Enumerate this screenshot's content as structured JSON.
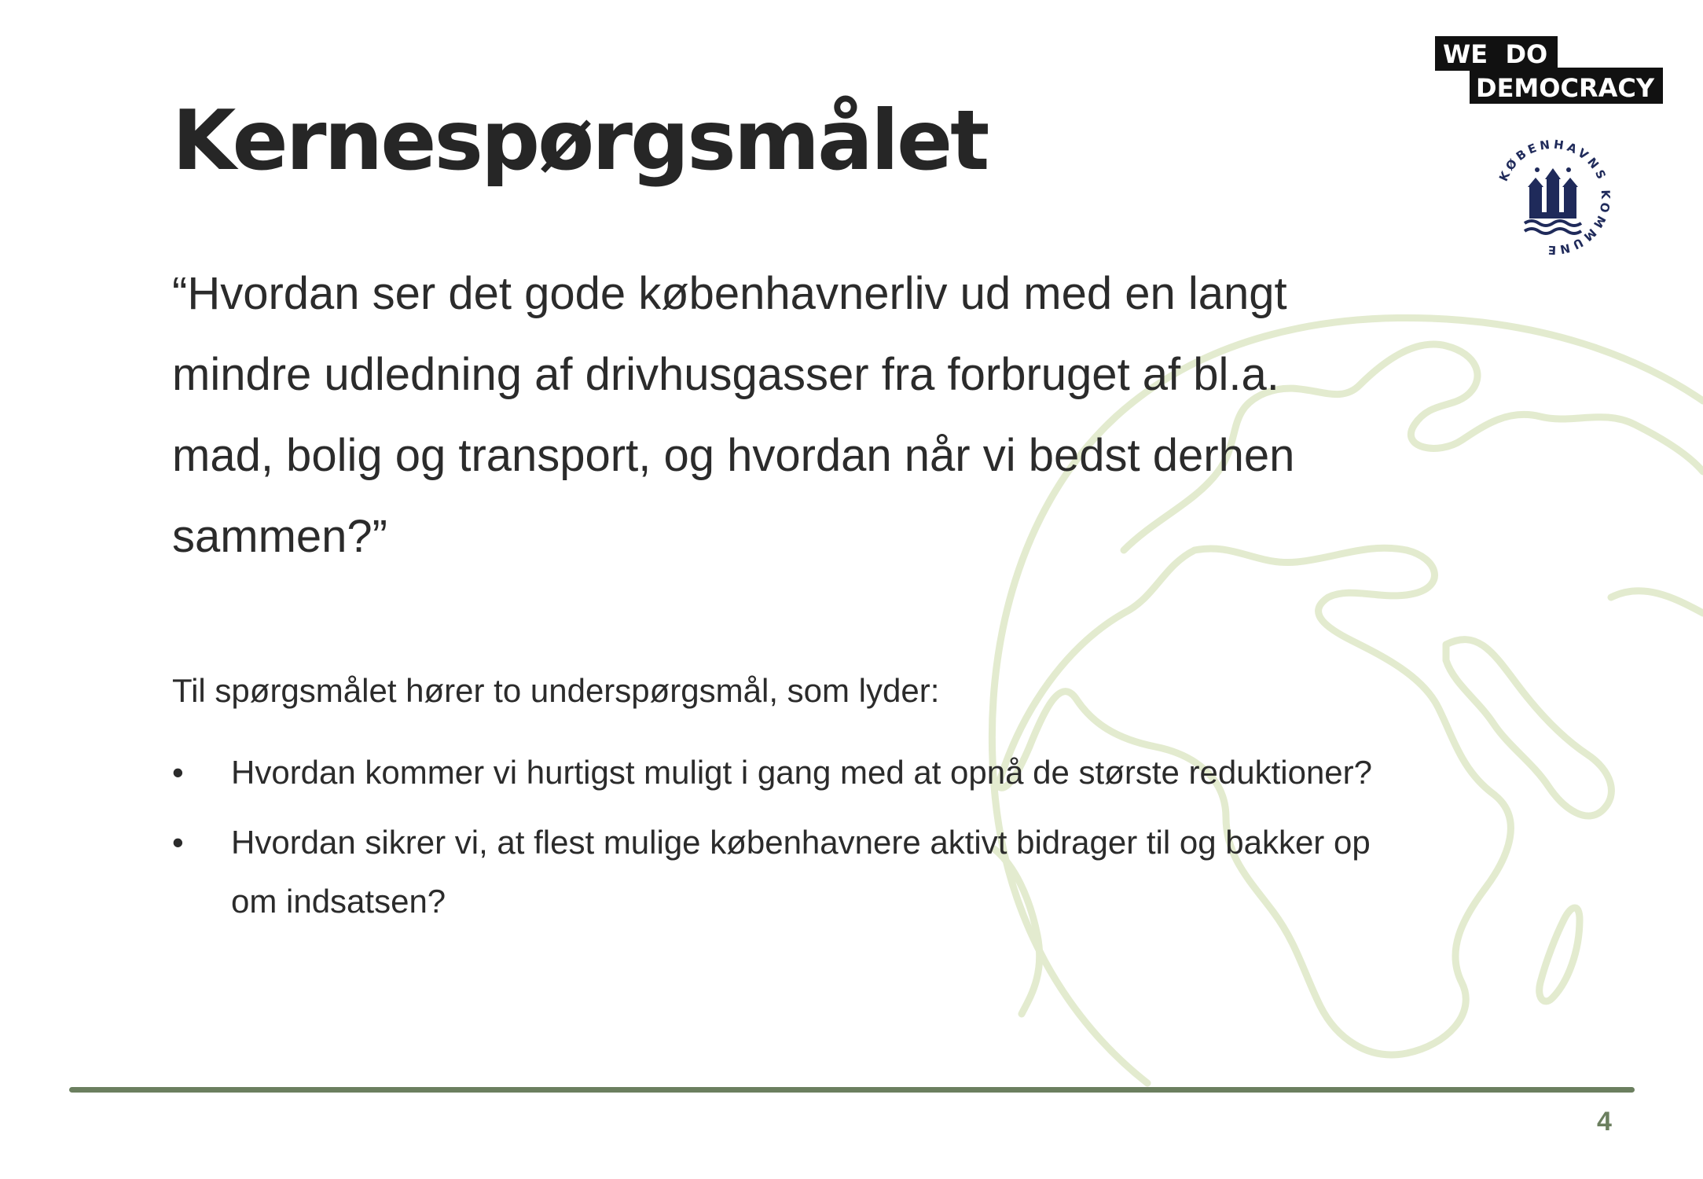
{
  "title": "Kernespørgsmålet",
  "question": "“Hvordan ser det gode københavnerliv ud med en langt mindre udledning af drivhusgasser fra forbruget af bl.a. mad, bolig og transport, og hvordan når vi bedst derhen sammen?”",
  "intro": "Til spørgsmålet hører to underspørgsmål, som lyder:",
  "bullet_symbol": "•",
  "subquestions": [
    "Hvordan kommer vi hurtigst muligt i gang med at opnå de største reduktioner?",
    "Hvordan sikrer vi, at flest mulige københavnere aktivt bidrager til og bakker op om indsatsen?"
  ],
  "logo_wedo": {
    "line1": "WE  DO",
    "line2": "DEMOCRACY"
  },
  "logo_kk": {
    "text": "KØBENHAVNS KOMMUNE",
    "icon": "castle-seal-icon"
  },
  "page_number": "4",
  "colors": {
    "accent": "#6b7f5f",
    "globe": "#e3ebcf",
    "text": "#2b2b2b",
    "seal": "#1f2a5a"
  }
}
